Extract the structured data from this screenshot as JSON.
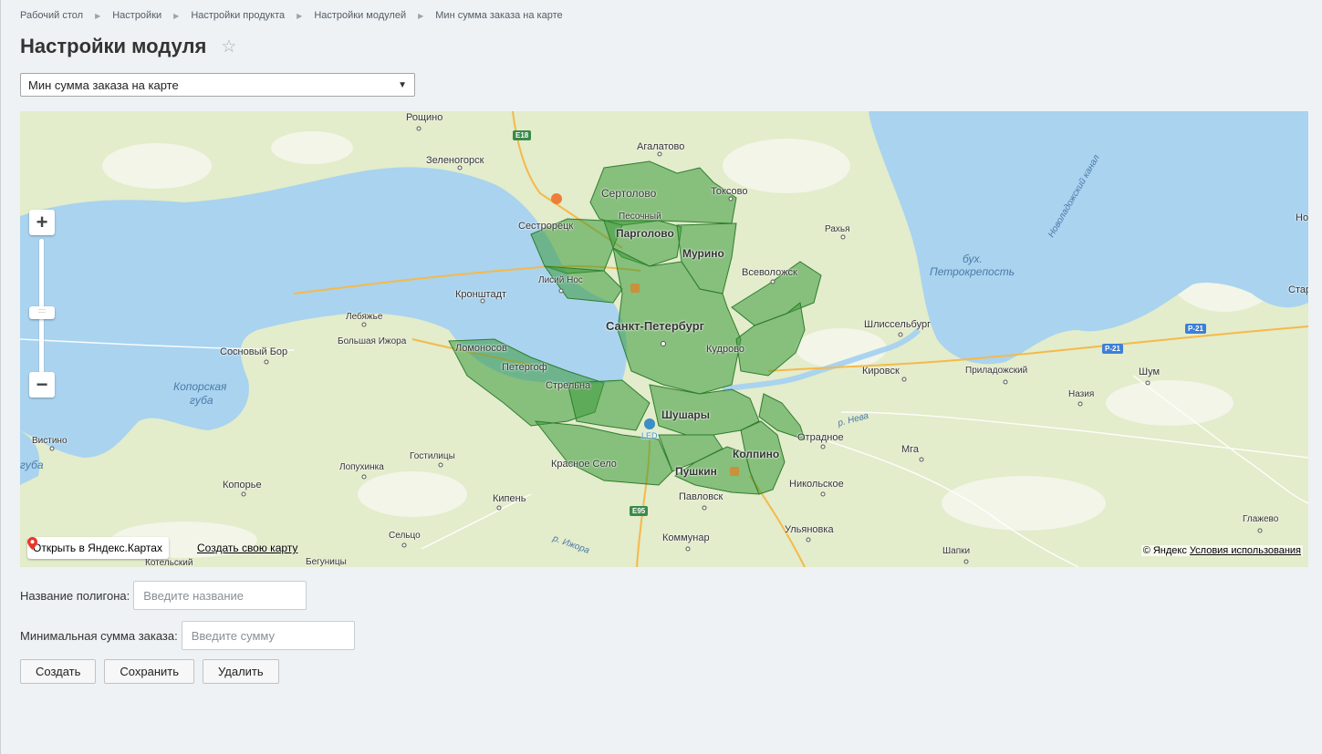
{
  "breadcrumbs": [
    {
      "label": "Рабочий стол"
    },
    {
      "label": "Настройки"
    },
    {
      "label": "Настройки продукта"
    },
    {
      "label": "Настройки модулей"
    },
    {
      "label": "Мин сумма заказа на карте"
    }
  ],
  "page": {
    "title": "Настройки модуля",
    "favorite_icon": "star-icon"
  },
  "module_select": {
    "selected": "Мин сумма заказа на карте"
  },
  "map": {
    "labels": {
      "roshchino": "Рощино",
      "zelenogorsk": "Зеленогорск",
      "agalatovo": "Агалатово",
      "toksovo": "Токсово",
      "sertolovo": "Сертолово",
      "pesochny": "Песочный",
      "sestroretsk": "Сестрорецк",
      "pargolovo": "Парголово",
      "murino": "Мурино",
      "rakhya": "Рахья",
      "vsevolozhsk": "Всеволожск",
      "lisiy_nos": "Лисий Нос",
      "kronshtadt": "Кронштадт",
      "spb": "Санкт-Петербург",
      "kudrovo": "Кудрово",
      "shlisselburg": "Шлиссельбург",
      "lebyazhye": "Лебяжье",
      "bolshaya_izhora": "Большая Ижора",
      "sosnovy_bor": "Сосновый Бор",
      "lomonosov": "Ломоносов",
      "petergof": "Петергоф",
      "strelna": "Стрельна",
      "kirovsk": "Кировск",
      "priladozhsky": "Приладожский",
      "shum": "Шум",
      "nazia": "Назия",
      "shushary": "Шушары",
      "led": "LED",
      "otradnoe": "Отрадное",
      "mga": "Мга",
      "kolpino": "Колпино",
      "krasnoe_selo": "Красное Село",
      "pushkin": "Пушкин",
      "nikolskoe": "Никольское",
      "vistino": "Вистино",
      "gostilitsy": "Гостилицы",
      "lopukhinka": "Лопухинка",
      "koporye": "Копорье",
      "kipen": "Кипень",
      "pavlovsk": "Павловск",
      "ulyanovka": "Ульяновка",
      "selco": "Сельцо",
      "kommunar": "Коммунар",
      "glazhevo": "Глажево",
      "shapki": "Шапки",
      "kotelsky": "Котельский",
      "begunitsy": "Бегуницы",
      "novoladozhsky_canal": "Новоладожский канал",
      "stara": "Стар",
      "no": "Но",
      "river_neva": "р. Нева",
      "river_izhora": "р. Ижора",
      "bay_koporskaya_1": "Копорская",
      "bay_koporskaya_2": "губа",
      "bay_petrokrepost_1": "бух.",
      "bay_petrokrepost_2": "Петрокрепость",
      "guba_edge": "губа"
    },
    "road_badges": {
      "e18": "E18",
      "e95": "E95",
      "r21a": "P-21",
      "r21b": "P-21"
    },
    "zoom": {
      "plus": "+",
      "minus": "−",
      "handle": "::::"
    },
    "open_yandex": "Открыть в Яндекс.Картах",
    "create_map": "Создать свою карту",
    "copyright": "© Яндекс",
    "terms": "Условия использования"
  },
  "form": {
    "polygon_name_label": "Название полигона:",
    "polygon_name_placeholder": "Введите название",
    "min_sum_label": "Минимальная сумма заказа:",
    "min_sum_placeholder": "Введите сумму"
  },
  "actions": {
    "create": "Создать",
    "save": "Сохранить",
    "delete": "Удалить"
  },
  "colors": {
    "polygon_fill": "#3c9a3c",
    "water": "#a9d3ef",
    "land": "#e3eccb"
  }
}
